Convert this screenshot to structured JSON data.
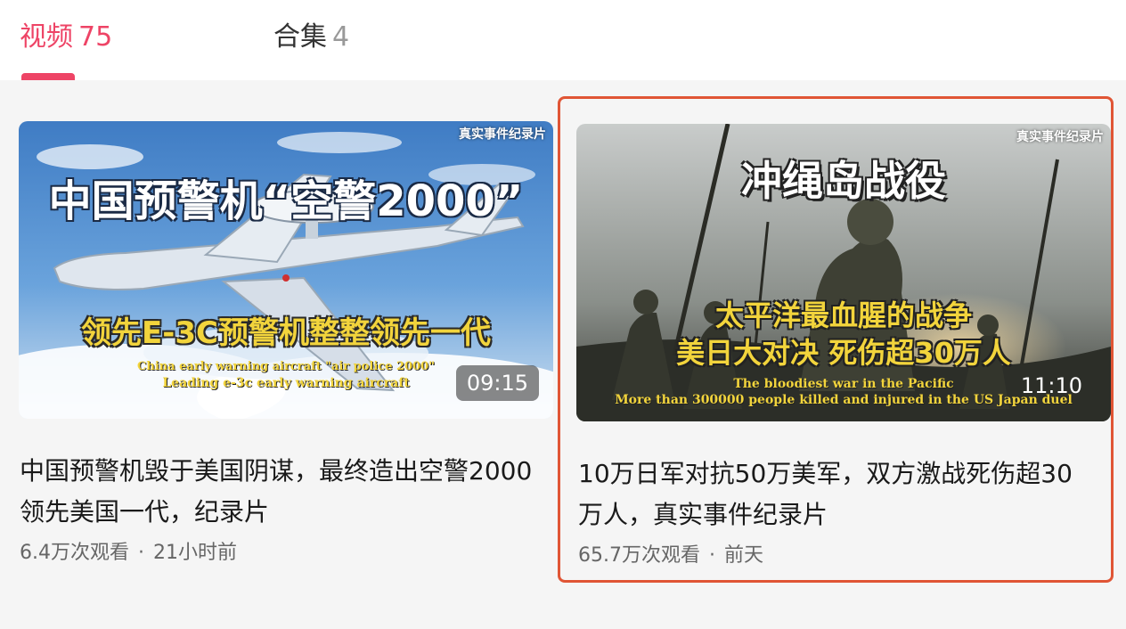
{
  "tabs": [
    {
      "label": "视频",
      "count": "75",
      "active": true
    },
    {
      "label": "合集",
      "count": "4",
      "active": false
    }
  ],
  "colors": {
    "accent": "#ee4466",
    "highlight_border": "#e05535",
    "caption_yellow": "#f2d43c"
  },
  "videos": [
    {
      "thumbnail": {
        "watermark": "真实事件纪录片",
        "headline": "中国预警机“空警2000”",
        "subheadline": "领先E-3C预警机整整领先一代",
        "english_line1": "China early warning aircraft \"air police 2000\"",
        "english_line2": "Leading e-3c early warning aircraft"
      },
      "duration": "09:15",
      "title": "中国预警机毁于美国阴谋，最终造出空警2000领先美国一代，纪录片",
      "views": "6.4万次观看",
      "time": "21小时前",
      "selected": false
    },
    {
      "thumbnail": {
        "watermark": "真实事件纪录片",
        "headline": "冲绳岛战役",
        "subheadline1": "太平洋最血腥的战争",
        "subheadline2": "美日大对决 死伤超30万人",
        "english_line1": "The bloodiest war in the Pacific",
        "english_line2": "More than 300000 people killed and injured in the US Japan duel"
      },
      "duration": "11:10",
      "title": "10万日军对抗50万美军，双方激战死伤超30万人，真实事件纪录片",
      "views": "65.7万次观看",
      "time": "前天",
      "selected": true
    }
  ],
  "separator": "·"
}
